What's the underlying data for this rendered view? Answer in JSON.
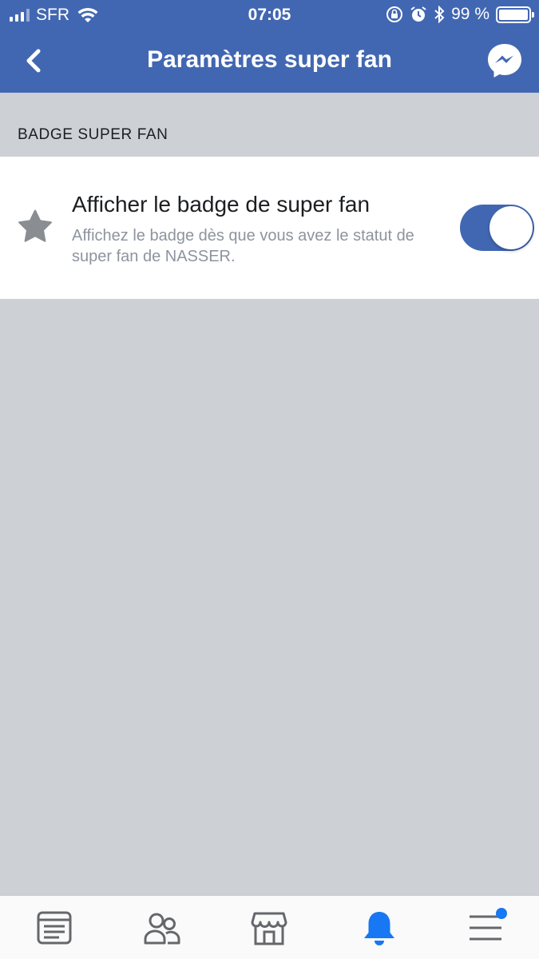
{
  "status_bar": {
    "carrier": "SFR",
    "time": "07:05",
    "battery": "99 %",
    "battery_level": 0.99
  },
  "header": {
    "title": "Paramètres super fan",
    "back_icon": "chevron-left-icon",
    "messenger_icon": "messenger-icon"
  },
  "section": {
    "title": "BADGE SUPER FAN"
  },
  "setting": {
    "title": "Afficher le badge de super fan",
    "description": "Affichez le badge dès que vous avez le statut de super fan de NASSER.",
    "enabled": true,
    "icon": "star-icon"
  },
  "tabbar": {
    "items": [
      {
        "icon": "news-feed-icon",
        "active": false
      },
      {
        "icon": "friends-icon",
        "active": false
      },
      {
        "icon": "marketplace-icon",
        "active": false
      },
      {
        "icon": "notifications-bell-icon",
        "active": true
      },
      {
        "icon": "menu-icon",
        "active": false,
        "badge_dot": true
      }
    ]
  },
  "colors": {
    "brand": "#4267b2",
    "background": "#cdd0d5",
    "active_tab": "#1877f2",
    "muted_text": "#8d949e"
  }
}
